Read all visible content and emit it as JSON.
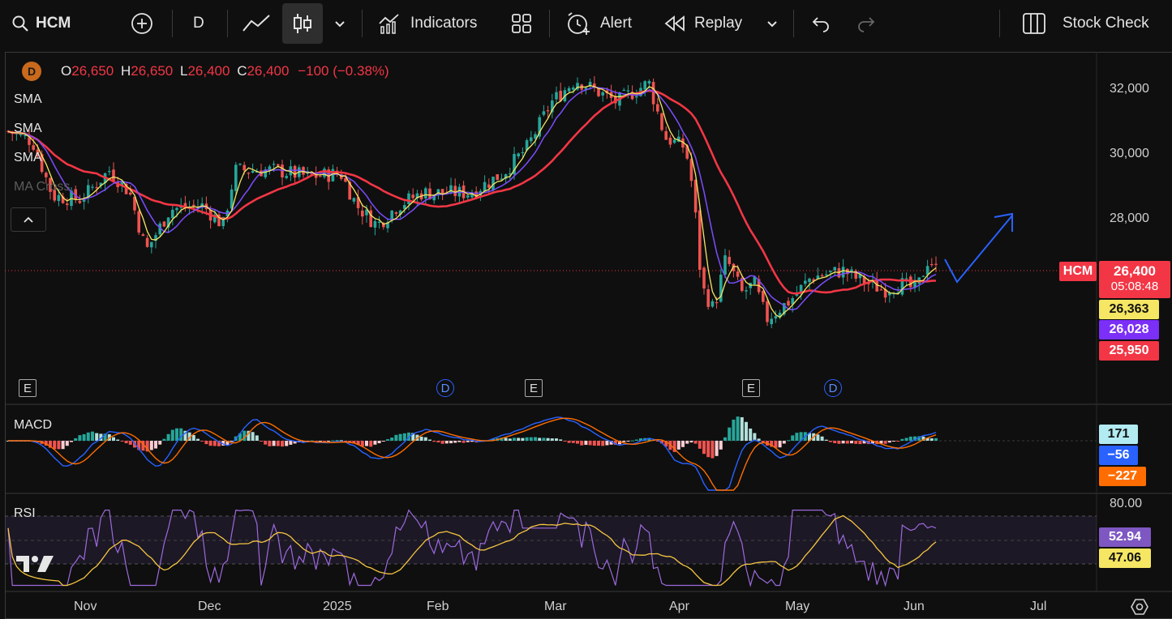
{
  "toolbar": {
    "symbol": "HCM",
    "interval": "D",
    "indicators_label": "Indicators",
    "alert_label": "Alert",
    "replay_label": "Replay",
    "stock_check_label": "Stock Check",
    "icons": [
      "search-icon",
      "add-icon",
      "line-chart-icon",
      "candles-icon",
      "chevron-down-icon",
      "indicators-icon",
      "layout-grid-icon",
      "alert-icon",
      "replay-icon",
      "undo-icon",
      "redo-icon",
      "columns-icon"
    ]
  },
  "legend": {
    "badge": "D",
    "o_label": "O",
    "o_value": "26,650",
    "h_label": "H",
    "h_value": "26,650",
    "l_label": "L",
    "l_value": "26,400",
    "c_label": "C",
    "c_value": "26,400",
    "change": "−100 (−0.38%)",
    "indicators": [
      "SMA",
      "SMA",
      "SMA",
      "MA Cross"
    ]
  },
  "price_axis": [
    "32,000",
    "30,000",
    "28,000"
  ],
  "price_tags": {
    "symbol": "HCM",
    "last": "26,400",
    "countdown": "05:08:48",
    "sma1": "26,363",
    "sma2": "26,028",
    "sma3": "25,950"
  },
  "events": {
    "e": "E",
    "d": "D"
  },
  "macd": {
    "label": "MACD",
    "hist": "171",
    "macd": "−56",
    "signal": "−227"
  },
  "rsi": {
    "label": "RSI",
    "level": "80.00",
    "value": "52.94",
    "ma": "47.06"
  },
  "time_axis": [
    "Nov",
    "Dec",
    "2025",
    "Feb",
    "Mar",
    "Apr",
    "May",
    "Jun",
    "Jul"
  ],
  "colors": {
    "up": "#26a69a",
    "down": "#ef5350",
    "sma_fast": "#f5e663",
    "sma_mid": "#7b4dff",
    "sma_slow": "#f23645",
    "macd": "#2962ff",
    "signal": "#ff6d00",
    "rsi": "#9c6ade",
    "rsi_ma": "#f5c542"
  },
  "chart_data": {
    "type": "line",
    "title": "HCM",
    "x": [
      "Nov",
      "Dec",
      "2025",
      "Feb",
      "Mar",
      "Apr",
      "May",
      "Jun"
    ],
    "series": [
      {
        "name": "SMA",
        "values": [
          28500,
          28300,
          29300,
          28700,
          31000,
          30500,
          25800,
          26400
        ]
      }
    ],
    "ylim": [
      24500,
      32800
    ],
    "y_ticks": [
      28000,
      30000,
      32000
    ]
  }
}
